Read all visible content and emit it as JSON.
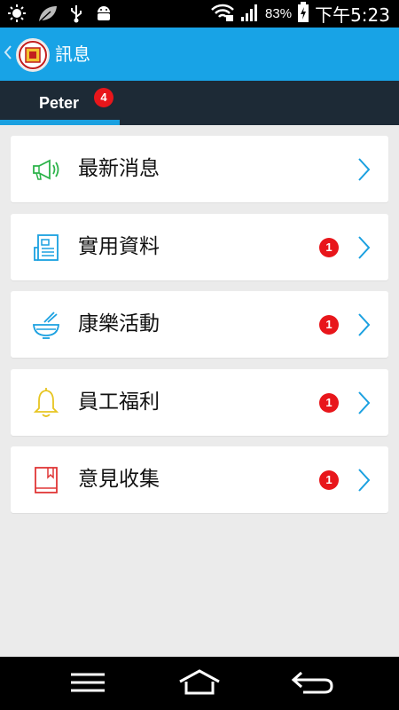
{
  "status_bar": {
    "battery": "83%",
    "time": "下午5:23",
    "icons": [
      "brightness-icon",
      "leaf-icon",
      "usb-icon",
      "android-icon",
      "wifi-icon",
      "signal-icon",
      "battery-charging-icon"
    ]
  },
  "app_bar": {
    "title": "訊息",
    "accent": "#18a3e6"
  },
  "tabs": [
    {
      "label": "Peter",
      "badge": "4",
      "active": true
    }
  ],
  "list": [
    {
      "label": "最新消息",
      "badge": "",
      "icon": "megaphone-icon",
      "icon_color": "#2db34a"
    },
    {
      "label": "實用資料",
      "badge": "1",
      "icon": "document-icon",
      "icon_color": "#1aa0e0"
    },
    {
      "label": "康樂活動",
      "badge": "1",
      "icon": "bowl-icon",
      "icon_color": "#1aa0e0"
    },
    {
      "label": "員工福利",
      "badge": "1",
      "icon": "bell-icon",
      "icon_color": "#e7c521"
    },
    {
      "label": "意見收集",
      "badge": "1",
      "icon": "book-icon",
      "icon_color": "#e03636"
    }
  ],
  "nav_bar": {
    "buttons": [
      "menu-icon",
      "home-icon",
      "back-icon"
    ]
  }
}
